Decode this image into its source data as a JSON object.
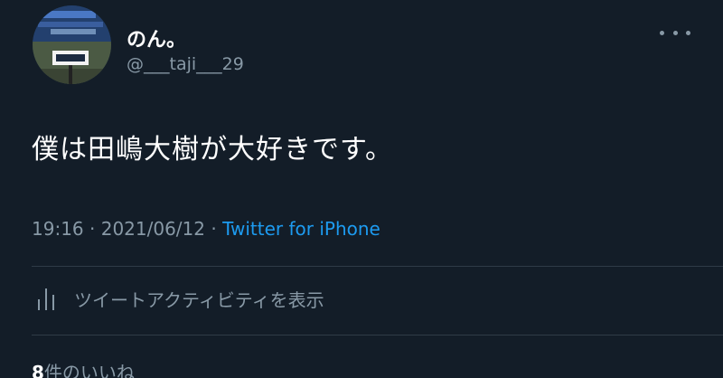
{
  "tweet": {
    "display_name": "のん。",
    "handle": "@___taji___29",
    "text": "僕は田嶋大樹が大好きです。",
    "time": "19:16",
    "separator": "·",
    "date": "2021/06/12",
    "source": "Twitter for iPhone",
    "activity_label": "ツイートアクティビティを表示",
    "likes_count": "8",
    "likes_label": "件のいいね"
  },
  "colors": {
    "background": "#131d28",
    "secondary_text": "#8899a6",
    "link": "#1d9bf0",
    "divider": "#2f3b47"
  },
  "icons": {
    "more": "more-horizontal-icon",
    "activity": "bar-chart-icon"
  }
}
